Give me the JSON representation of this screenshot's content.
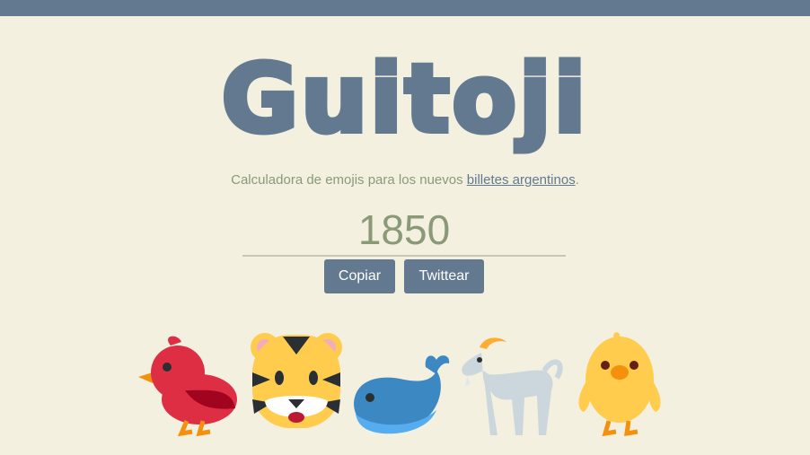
{
  "header": {
    "logo_text": "Guitoji"
  },
  "intro": {
    "text": "Calculadora de emojis para los nuevos ",
    "link_text": "billetes argentinos",
    "suffix": "."
  },
  "calculator": {
    "amount_value": "1850"
  },
  "actions": {
    "copy_label": "Copiar",
    "tweet_label": "Twittear"
  },
  "emojis": [
    {
      "name": "cardinal-bird",
      "icon": "bird-icon"
    },
    {
      "name": "tiger",
      "icon": "tiger-face-icon"
    },
    {
      "name": "whale",
      "icon": "whale-icon"
    },
    {
      "name": "goat",
      "icon": "goat-icon"
    },
    {
      "name": "chick",
      "icon": "chick-icon"
    }
  ],
  "colors": {
    "background": "#f3f0e0",
    "accent": "#627990",
    "text_muted": "#8a9a78"
  }
}
